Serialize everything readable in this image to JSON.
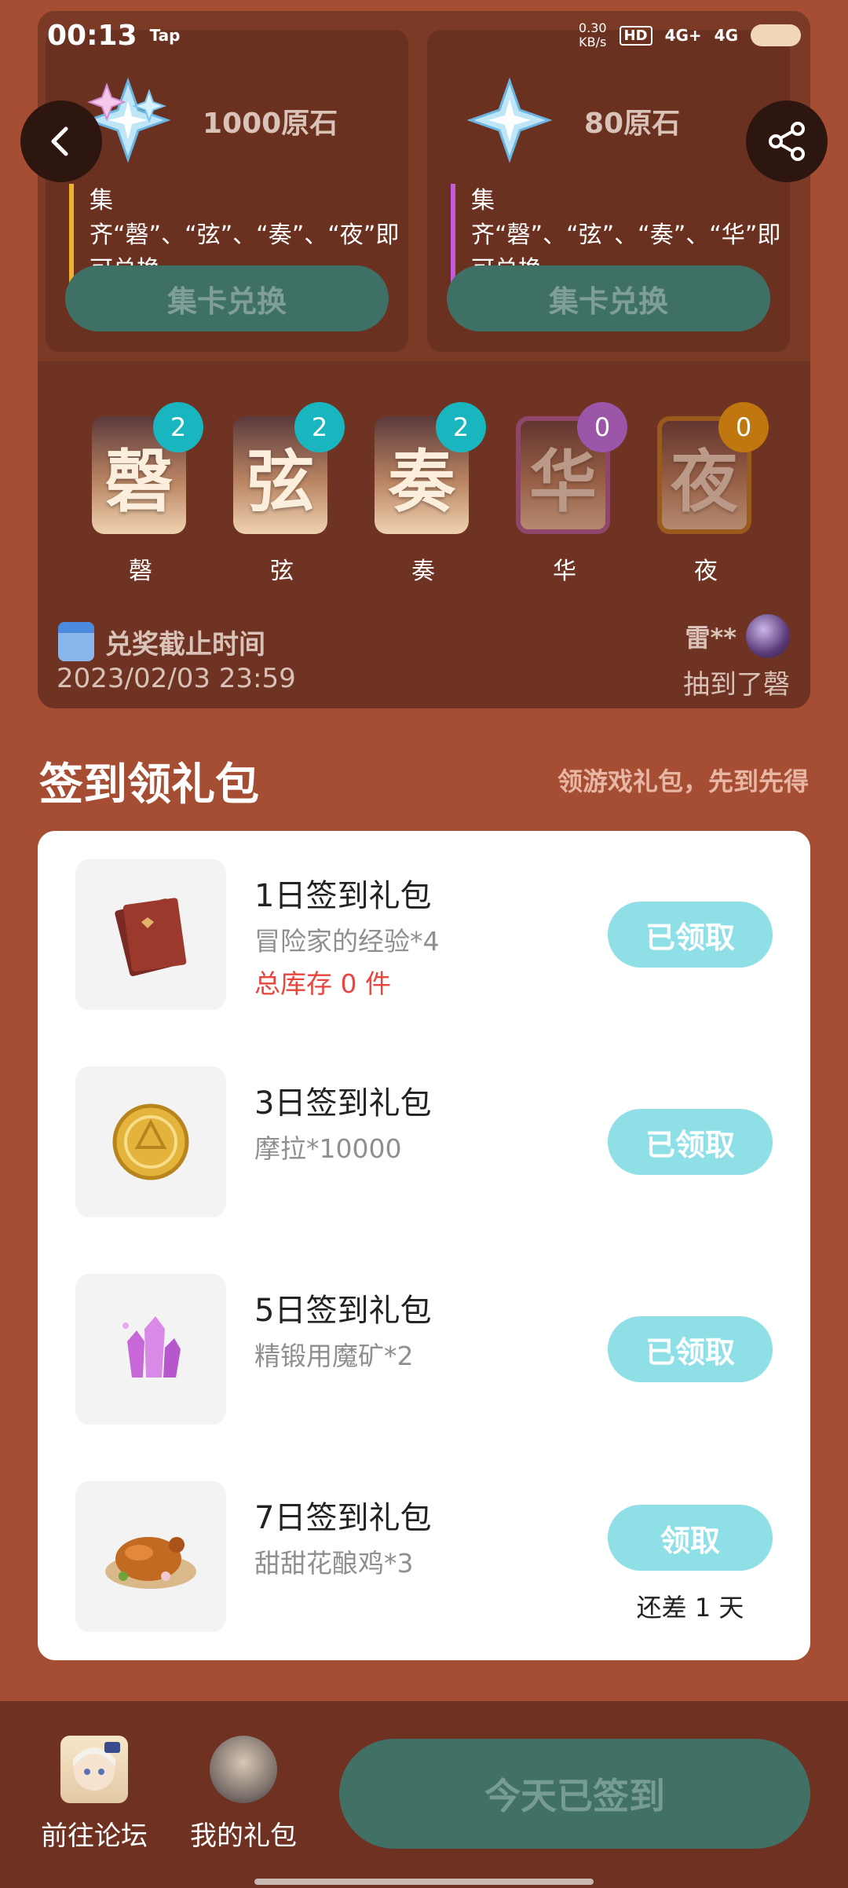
{
  "status_bar": {
    "time": "00:13",
    "app_tag": "Tap",
    "speed_value": "0.30",
    "speed_unit": "KB/s",
    "hd": "HD",
    "net1": "4G+",
    "net2": "4G"
  },
  "exchange": [
    {
      "reward": "1000原石",
      "desc": "集齐“磬”、“弦”、“奏”、“夜”即可兑换",
      "button": "集卡兑换",
      "accent": "#f0b030"
    },
    {
      "reward": "80原石",
      "desc": "集齐“磬”、“弦”、“奏”、“华”即可兑换",
      "button": "集卡兑换",
      "accent": "#c35bdc"
    }
  ],
  "cards": [
    {
      "char": "磬",
      "count": "2",
      "label": "磬"
    },
    {
      "char": "弦",
      "count": "2",
      "label": "弦"
    },
    {
      "char": "奏",
      "count": "2",
      "label": "奏"
    },
    {
      "char": "华",
      "count": "0",
      "label": "华"
    },
    {
      "char": "夜",
      "count": "0",
      "label": "夜"
    }
  ],
  "deadline": {
    "label": "兑奖截止时间",
    "date": "2023/02/03 23:59"
  },
  "winner": {
    "name": "雷**",
    "text": "抽到了磬"
  },
  "signin": {
    "title": "签到领礼包",
    "subtitle": "领游戏礼包，先到先得",
    "gifts": [
      {
        "name": "1日签到礼包",
        "desc": "冒险家的经验*4",
        "stock": "总库存 0 件",
        "button": "已领取",
        "icon": "book-icon"
      },
      {
        "name": "3日签到礼包",
        "desc": "摩拉*10000",
        "button": "已领取",
        "icon": "coin-icon"
      },
      {
        "name": "5日签到礼包",
        "desc": "精锻用魔矿*2",
        "button": "已领取",
        "icon": "crystal-icon"
      },
      {
        "name": "7日签到礼包",
        "desc": "甜甜花酿鸡*3",
        "button": "领取",
        "note": "还差 1 天",
        "icon": "roast-chicken-icon"
      }
    ]
  },
  "bottom_bar": {
    "forum_label": "前往论坛",
    "gifts_label": "我的礼包",
    "signin_button": "今天已签到"
  },
  "colors": {
    "background": "#a54e33",
    "panel": "#6e3322",
    "teal_button": "#3e7066",
    "claim_button": "#8ee0e6",
    "badge_teal": "#19b6c0",
    "badge_purple": "#9c56a9",
    "badge_orange": "#c0770f",
    "stock_red": "#e8453c"
  }
}
